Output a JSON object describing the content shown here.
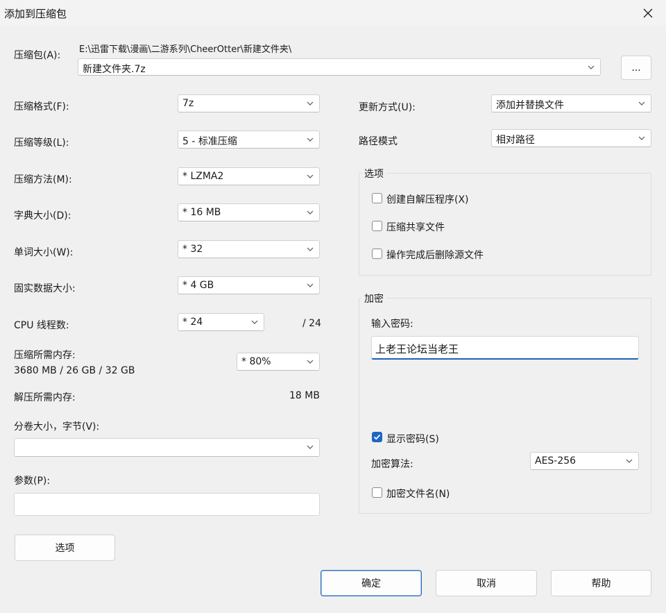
{
  "window": {
    "title": "添加到压缩包"
  },
  "archive": {
    "label": "压缩包(A):",
    "path": "E:\\迅雷下载\\漫画\\二游系列\\CheerOtter\\新建文件夹\\",
    "filename": "新建文件夹.7z",
    "browse_label": "..."
  },
  "left": {
    "format": {
      "label": "压缩格式(F):",
      "value": "7z"
    },
    "level": {
      "label": "压缩等级(L):",
      "value": "5 - 标准压缩"
    },
    "method": {
      "label": "压缩方法(M):",
      "value": "* LZMA2"
    },
    "dict": {
      "label": "字典大小(D):",
      "value": "* 16 MB"
    },
    "word": {
      "label": "单词大小(W):",
      "value": "* 32"
    },
    "solid": {
      "label": "固实数据大小:",
      "value": "* 4 GB"
    },
    "cpu": {
      "label": "CPU 线程数:",
      "value": "* 24",
      "max": "/ 24"
    },
    "mem_comp": {
      "label": "压缩所需内存:",
      "detail": "3680 MB / 26 GB / 32 GB",
      "value": "* 80%"
    },
    "mem_decomp": {
      "label": "解压所需内存:",
      "value": "18 MB"
    },
    "volume": {
      "label": "分卷大小，字节(V):",
      "value": ""
    },
    "params": {
      "label": "参数(P):",
      "value": ""
    },
    "options_button": "选项"
  },
  "right": {
    "update": {
      "label": "更新方式(U):",
      "value": "添加并替换文件"
    },
    "pathmode": {
      "label": "路径模式",
      "value": "相对路径"
    },
    "options_group": {
      "title": "选项",
      "sfx": "创建自解压程序(X)",
      "shared": "压缩共享文件",
      "delete": "操作完成后删除源文件"
    },
    "encryption": {
      "title": "加密",
      "password_label": "输入密码:",
      "password_value": "上老王论坛当老王",
      "show_password": "显示密码(S)",
      "method_label": "加密算法:",
      "method_value": "AES-256",
      "encrypt_names": "加密文件名(N)"
    }
  },
  "buttons": {
    "ok": "确定",
    "cancel": "取消",
    "help": "帮助"
  },
  "colors": {
    "accent": "#1f66c4",
    "focus_underline": "#1f5fb8"
  }
}
